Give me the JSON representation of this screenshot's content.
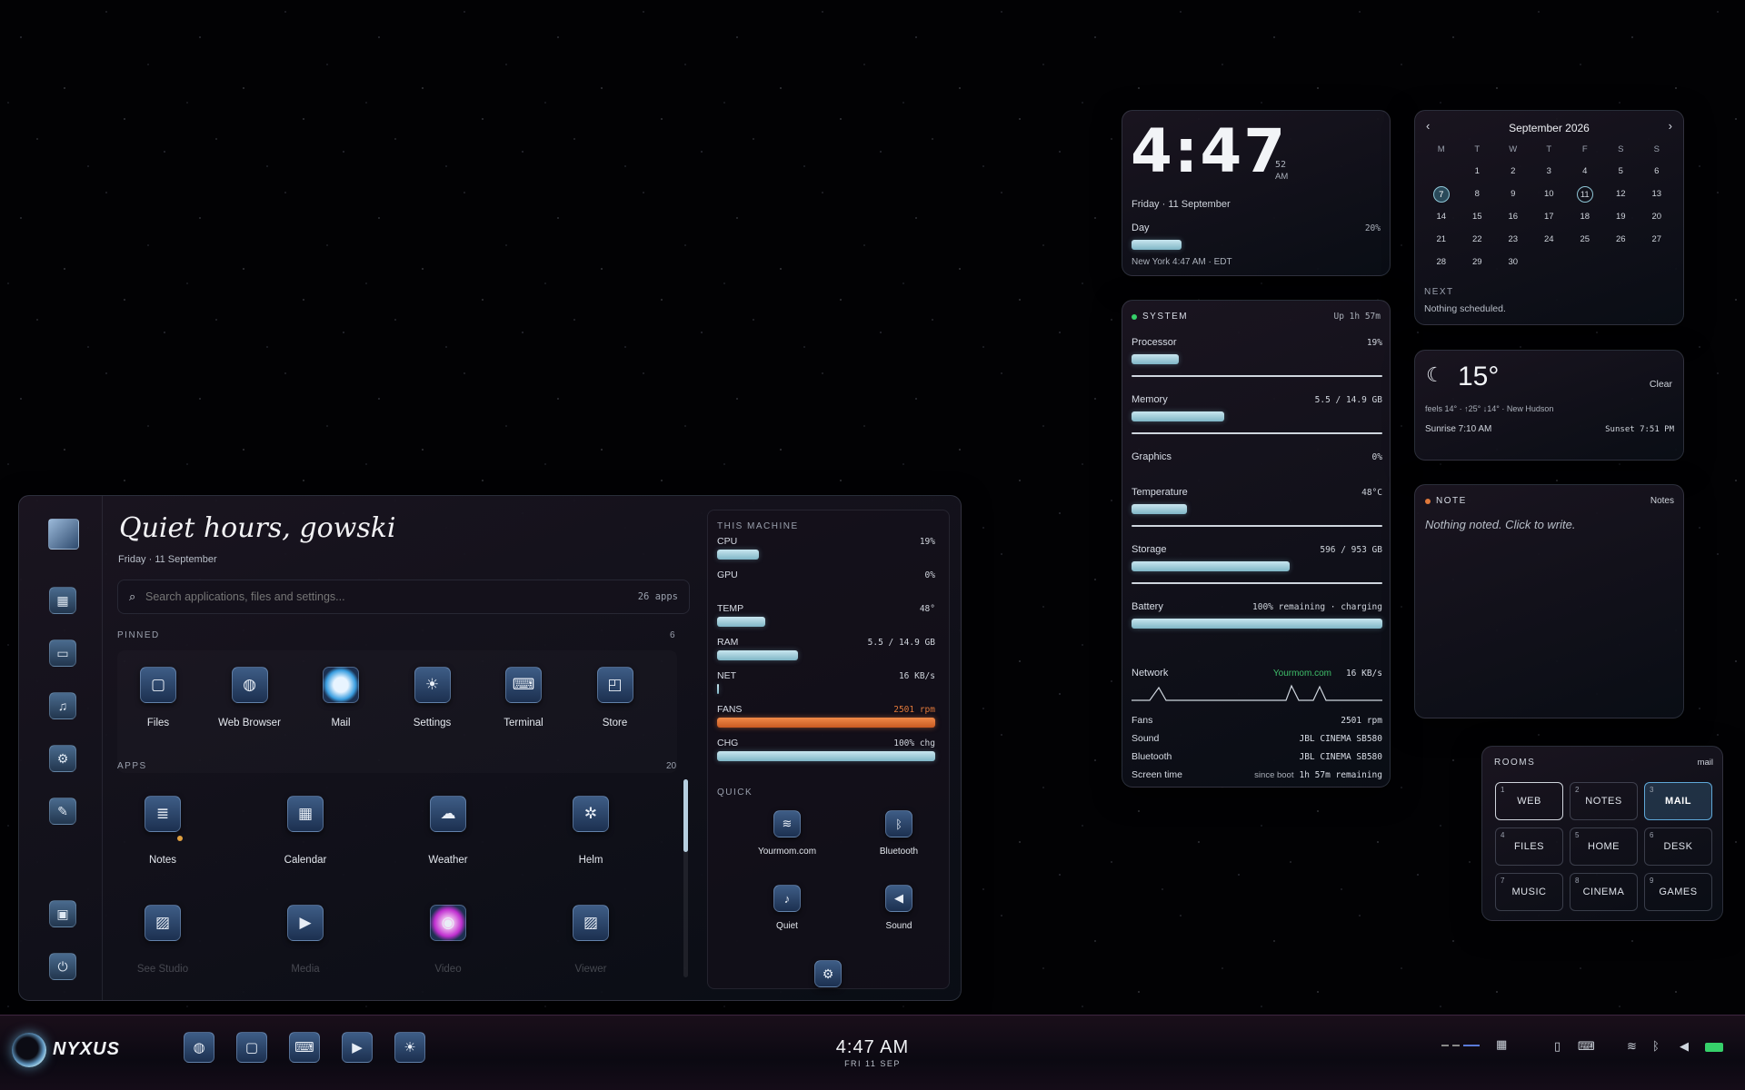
{
  "launcher": {
    "greeting": "Quiet hours, gowski",
    "date": "Friday · 11 September",
    "search_placeholder": "Search applications, files and settings...",
    "app_count": "26 apps",
    "pinned_label": "PINNED",
    "pinned_count": "6",
    "pinned": [
      {
        "label": "Files",
        "icon": "folder-icon"
      },
      {
        "label": "Web Browser",
        "icon": "globe-icon"
      },
      {
        "label": "Mail",
        "icon": "mail-orb-icon"
      },
      {
        "label": "Settings",
        "icon": "sun-icon"
      },
      {
        "label": "Terminal",
        "icon": "terminal-icon"
      },
      {
        "label": "Store",
        "icon": "bag-icon"
      }
    ],
    "apps_label": "APPS",
    "apps_count": "20",
    "apps": [
      {
        "label": "Notes",
        "icon": "document-icon"
      },
      {
        "label": "Calendar",
        "icon": "calendar-icon"
      },
      {
        "label": "Weather",
        "icon": "cloud-icon"
      },
      {
        "label": "Helm",
        "icon": "helm-icon"
      }
    ],
    "apps_row2": [
      {
        "label": "See Studio",
        "icon": "image-icon"
      },
      {
        "label": "Media",
        "icon": "play-icon"
      },
      {
        "label": "Video",
        "icon": "play-circle-icon"
      },
      {
        "label": "Viewer",
        "icon": "image-icon"
      }
    ],
    "machine": {
      "title": "THIS MACHINE",
      "cpu": {
        "label": "CPU",
        "value": "19%",
        "level": 0.19
      },
      "gpu": {
        "label": "GPU",
        "value": "0%",
        "level": 0
      },
      "temp": {
        "label": "TEMP",
        "value": "48°",
        "level": 0.22
      },
      "ram": {
        "label": "RAM",
        "value": "5.5 / 14.9 GB",
        "level": 0.37
      },
      "net": {
        "label": "NET",
        "value": "16 KB/s",
        "level": 0.01
      },
      "fans": {
        "label": "FANS",
        "value": "2501 rpm",
        "level": 1
      },
      "chg": {
        "label": "CHG",
        "value": "100% chg",
        "level": 1
      }
    },
    "quick": {
      "title": "QUICK",
      "items": [
        {
          "label": "Yourmom.com",
          "icon": "wifi-icon"
        },
        {
          "label": "Bluetooth",
          "icon": "bluetooth-icon"
        },
        {
          "label": "Quiet",
          "icon": "bell-icon"
        },
        {
          "label": "Sound",
          "icon": "speaker-icon"
        }
      ]
    }
  },
  "clock": {
    "time": "4:47",
    "seconds": "52",
    "ampm": "AM",
    "date": "Friday · 11 September",
    "day_label": "Day",
    "day_pct": "20%",
    "day_level": 0.2,
    "zone": "New York 4:47 AM · EDT"
  },
  "calendar": {
    "month": "September 2026",
    "weekdays": [
      "M",
      "T",
      "W",
      "T",
      "F",
      "S",
      "S"
    ],
    "weeks": [
      [
        "",
        "1",
        "2",
        "3",
        "4",
        "5",
        "6"
      ],
      [
        "7",
        "8",
        "9",
        "10",
        "11",
        "12",
        "13"
      ],
      [
        "14",
        "15",
        "16",
        "17",
        "18",
        "19",
        "20"
      ],
      [
        "21",
        "22",
        "23",
        "24",
        "25",
        "26",
        "27"
      ],
      [
        "28",
        "29",
        "30",
        "",
        "",
        "",
        ""
      ]
    ],
    "next_label": "NEXT",
    "next_text": "Nothing scheduled."
  },
  "system": {
    "title": "SYSTEM",
    "uptime": "Up 1h 57m",
    "processor": {
      "label": "Processor",
      "value": "19%",
      "level": 0.19
    },
    "memory": {
      "label": "Memory",
      "value": "5.5 / 14.9 GB",
      "level": 0.37
    },
    "graphics": {
      "label": "Graphics",
      "value": "0%",
      "level": 0
    },
    "temperature": {
      "label": "Temperature",
      "value": "48°C",
      "level": 0.22
    },
    "storage": {
      "label": "Storage",
      "value": "596 / 953 GB",
      "level": 0.63
    },
    "battery": {
      "label": "Battery",
      "value": "100% remaining · charging",
      "level": 1
    },
    "network": {
      "label": "Network",
      "ssid": "Yourmom.com",
      "rate": "16 KB/s"
    },
    "fans": {
      "label": "Fans",
      "value": "2501 rpm"
    },
    "sound": {
      "label": "Sound",
      "value": "JBL CINEMA SB580"
    },
    "bluetooth": {
      "label": "Bluetooth",
      "value": "JBL CINEMA SB580"
    },
    "screen": {
      "label": "Screen time",
      "since": "since boot",
      "value": "1h 57m remaining"
    }
  },
  "weather": {
    "temp": "15°",
    "cond": "Clear",
    "detail": "feels 14° · ↑25° ↓14° · New Hudson",
    "sunrise": "Sunrise 7:10 AM",
    "sunset": "Sunset 7:51 PM"
  },
  "note": {
    "title": "NOTE",
    "link": "Notes",
    "body": "Nothing noted. Click to write."
  },
  "rooms": {
    "title": "ROOMS",
    "current": "mail",
    "items": [
      {
        "n": "1",
        "t": "WEB"
      },
      {
        "n": "2",
        "t": "NOTES"
      },
      {
        "n": "3",
        "t": "MAIL"
      },
      {
        "n": "4",
        "t": "FILES"
      },
      {
        "n": "5",
        "t": "HOME"
      },
      {
        "n": "6",
        "t": "DESK"
      },
      {
        "n": "7",
        "t": "MUSIC"
      },
      {
        "n": "8",
        "t": "CINEMA"
      },
      {
        "n": "9",
        "t": "GAMES"
      }
    ]
  },
  "taskbar": {
    "logo": "NYXUS",
    "time": "4:47 AM",
    "date": "FRI 11 SEP"
  },
  "colors": {
    "accent": "#8fc6d6",
    "fans": "#e0783a",
    "network": "#3fbf6a",
    "status": "#36d06a",
    "room_active": "#5fa8d8"
  }
}
